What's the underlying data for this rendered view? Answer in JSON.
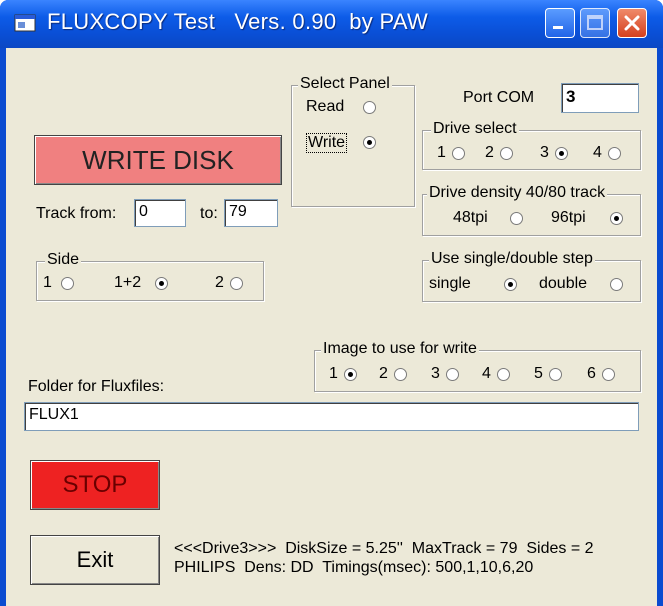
{
  "window": {
    "title": "FLUXCOPY Test   Vers. 0.90  by PAW",
    "controls": [
      "minimize-icon",
      "maximize-icon",
      "close-icon"
    ]
  },
  "write_button": {
    "label": "WRITE DISK",
    "color": "#f08080"
  },
  "track": {
    "from_label": "Track from:",
    "from_value": "0",
    "to_label": "to:",
    "to_value": "79"
  },
  "side": {
    "title": "Side",
    "options": [
      {
        "label": "1",
        "selected": false
      },
      {
        "label": "1+2",
        "selected": true
      },
      {
        "label": "2",
        "selected": false
      }
    ]
  },
  "select_panel": {
    "title": "Select Panel",
    "options": [
      {
        "label": "Read",
        "selected": false
      },
      {
        "label": "Write",
        "selected": true
      }
    ]
  },
  "port": {
    "label": "Port COM",
    "value": "3"
  },
  "drive_select": {
    "title": "Drive select",
    "options": [
      {
        "label": "1",
        "selected": false
      },
      {
        "label": "2",
        "selected": false
      },
      {
        "label": "3",
        "selected": true
      },
      {
        "label": "4",
        "selected": false
      }
    ]
  },
  "drive_density": {
    "title": "Drive density 40/80 track",
    "options": [
      {
        "label": "48tpi",
        "selected": false
      },
      {
        "label": "96tpi",
        "selected": true
      }
    ]
  },
  "step": {
    "title": "Use single/double step",
    "options": [
      {
        "label": "single",
        "selected": true
      },
      {
        "label": "double",
        "selected": false
      }
    ]
  },
  "image": {
    "title": "Image to use for write",
    "options": [
      {
        "label": "1",
        "selected": true
      },
      {
        "label": "2",
        "selected": false
      },
      {
        "label": "3",
        "selected": false
      },
      {
        "label": "4",
        "selected": false
      },
      {
        "label": "5",
        "selected": false
      },
      {
        "label": "6",
        "selected": false
      }
    ]
  },
  "folder": {
    "label": "Folder for Fluxfiles:",
    "value": "FLUX1"
  },
  "stop_button": {
    "label": "STOP",
    "color": "#ee2222"
  },
  "exit_button": {
    "label": "Exit"
  },
  "status": {
    "line1": "<<<Drive3>>>  DiskSize = 5.25''  MaxTrack = 79  Sides = 2",
    "line2": "PHILIPS  Dens: DD  Timings(msec): 500,1,10,6,20"
  }
}
